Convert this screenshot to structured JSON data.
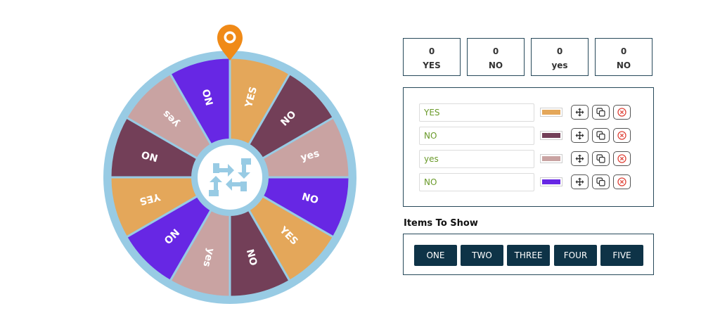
{
  "wheel": {
    "rim_color": "#98cbe4",
    "hub_color": "#98cbe4",
    "pointer_color": "#f08a17",
    "segments": [
      {
        "label": "YES",
        "color": "#e4a75a"
      },
      {
        "label": "NO",
        "color": "#733f58"
      },
      {
        "label": "yes",
        "color": "#c9a3a2"
      },
      {
        "label": "NO",
        "color": "#6727e4"
      },
      {
        "label": "YES",
        "color": "#e4a75a"
      },
      {
        "label": "NO",
        "color": "#733f58"
      },
      {
        "label": "yes",
        "color": "#c9a3a2"
      },
      {
        "label": "NO",
        "color": "#6727e4"
      },
      {
        "label": "YES",
        "color": "#e4a75a"
      },
      {
        "label": "NO",
        "color": "#733f58"
      },
      {
        "label": "yes",
        "color": "#c9a3a2"
      },
      {
        "label": "NO",
        "color": "#6727e4"
      }
    ],
    "spin_icon": "refresh-arrows-icon",
    "pointer_icon": "map-pin-icon"
  },
  "counters": [
    {
      "count": "0",
      "label": "YES"
    },
    {
      "count": "0",
      "label": "NO"
    },
    {
      "count": "0",
      "label": "yes"
    },
    {
      "count": "0",
      "label": "NO"
    }
  ],
  "items": [
    {
      "value": "YES",
      "color": "#e4a75a"
    },
    {
      "value": "NO",
      "color": "#733f58"
    },
    {
      "value": "yes",
      "color": "#c9a3a2"
    },
    {
      "value": "NO",
      "color": "#6727e4"
    }
  ],
  "item_actions": {
    "move_icon": "move-arrows-icon",
    "duplicate_icon": "copy-icon",
    "delete_icon": "close-circle-icon",
    "delete_color": "#e0483e"
  },
  "items_to_show": {
    "title": "Items To Show",
    "options": [
      "ONE",
      "TWO",
      "THREE",
      "FOUR",
      "FIVE"
    ],
    "button_color": "#0e3347"
  }
}
